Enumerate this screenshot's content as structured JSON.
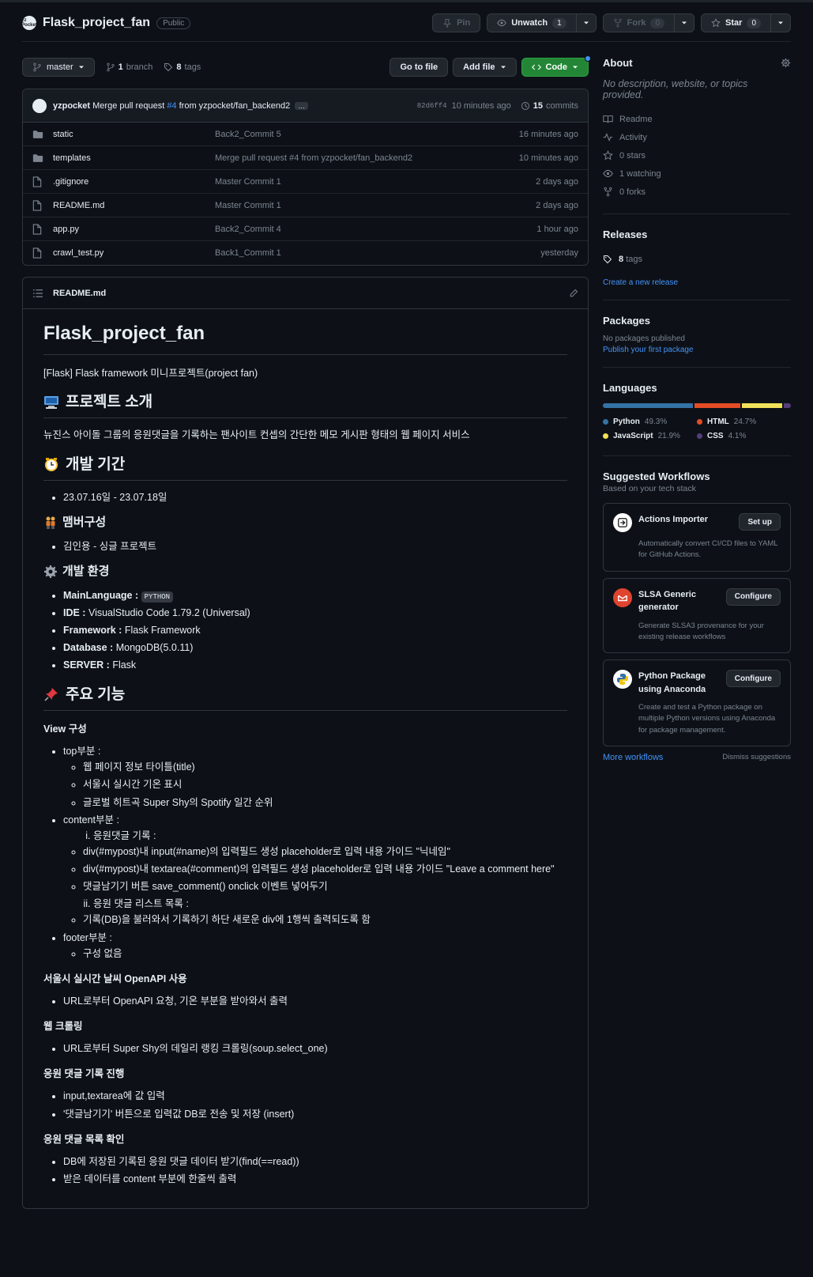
{
  "repo": {
    "name": "Flask_project_fan",
    "visibility": "Public",
    "avatar_text": "yz Pocket"
  },
  "header_actions": {
    "pin": "Pin",
    "unwatch": "Unwatch",
    "unwatch_count": "1",
    "fork": "Fork",
    "fork_count": "0",
    "star": "Star",
    "star_count": "0"
  },
  "branch_bar": {
    "branch": "master",
    "branch_count": "1",
    "branch_label": "branch",
    "tag_count": "8",
    "tag_label": "tags",
    "go_to_file": "Go to file",
    "add_file": "Add file",
    "code": "Code"
  },
  "latest_commit": {
    "author": "yzpocket",
    "message_prefix": "Merge pull request",
    "pr": "#4",
    "message_suffix": "from yzpocket/fan_backend2",
    "sha": "82d6ff4",
    "age": "10 minutes ago",
    "commit_count": "15",
    "commits_label": "commits"
  },
  "files": [
    {
      "type": "folder",
      "name": "static",
      "message": "Back2_Commit 5",
      "age": "16 minutes ago"
    },
    {
      "type": "folder",
      "name": "templates",
      "message": "Merge pull request #4 from yzpocket/fan_backend2",
      "age": "10 minutes ago"
    },
    {
      "type": "file",
      "name": ".gitignore",
      "message": "Master Commit 1",
      "age": "2 days ago"
    },
    {
      "type": "file",
      "name": "README.md",
      "message": "Master Commit 1",
      "age": "2 days ago"
    },
    {
      "type": "file",
      "name": "app.py",
      "message": "Back2_Commit 4",
      "age": "1 hour ago"
    },
    {
      "type": "file",
      "name": "crawl_test.py",
      "message": "Back1_Commit 1",
      "age": "yesterday"
    }
  ],
  "readme": {
    "filename": "README.md",
    "title": "Flask_project_fan",
    "subtitle": "[Flask] Flask framework 미니프로젝트(project fan)",
    "h_intro": "프로젝트 소개",
    "intro_text": "뉴진스 아이돌 그룹의 응원댓글을 기록하는 팬사이트 컨셉의 간단한 메모 게시판 형태의 웹 페이지 서비스",
    "h_period": "개발 기간",
    "period": "23.07.16일 - 23.07.18일",
    "h_members": "맴버구성",
    "members": "김인용 - 싱글 프로젝트",
    "h_env": "개발 환경",
    "env": [
      {
        "key": "MainLanguage :",
        "value": "PYTHON",
        "code": true
      },
      {
        "key": "IDE :",
        "value": "VisualStudio Code 1.79.2 (Universal)"
      },
      {
        "key": "Framework :",
        "value": "Flask Framework"
      },
      {
        "key": "Database :",
        "value": "MongoDB(5.0.11)"
      },
      {
        "key": "SERVER :",
        "value": "Flask"
      }
    ],
    "h_features": "주요 기능",
    "h_view": "View 구성",
    "top": "top부분 :",
    "top_items": [
      "웹 페이지 정보 타이틀(title)",
      "서울시 실시간 기온 표시",
      "글로벌 히트곡 Super Shy의 Spotify 일간 순위"
    ],
    "content": "content부분 :",
    "content_i": "응원댓글 기록 :",
    "content_i_items": [
      "div(#mypost)내 input(#name)의 입력필드 생성 placeholder로 입력 내용 가이드 \"닉네임\"",
      "div(#mypost)내 textarea(#comment)의 입력필드 생성 placeholder로 입력 내용 가이드 \"Leave a comment here\"",
      "댓글남기기 버튼 save_comment() onclick 이벤트 넣어두기"
    ],
    "content_ii": "응원 댓글 리스트 목록 :",
    "content_ii_items": [
      "기록(DB)을 불러와서 기록하기 하단 새로운 div에 1행씩 출력되도록 함"
    ],
    "footer": "footer부분 :",
    "footer_items": [
      "구성 없음"
    ],
    "h_weather": "서울시 실시간 날씨 OpenAPI 사용",
    "weather_items": [
      "URL로부터 OpenAPI 요청, 기온 부분을 받아와서 출력"
    ],
    "h_crawl": "웹 크롤링",
    "crawl_items": [
      "URL로부터 Super Shy의 데일리 랭킹 크롤링(soup.select_one)"
    ],
    "h_record": "응원 댓글 기록 진행",
    "record_items": [
      "input,textarea에 값 입력",
      "'댓글남기기' 버튼으로 입력값 DB로 전송 및 저장 (insert)"
    ],
    "h_list": "응원 댓글 목록 확인",
    "list_items": [
      "DB에 저장된 기록된 응원 댓글 데이터 받기(find(==read))",
      "받은 데이터를 content 부분에 한줄씩 출력"
    ]
  },
  "about": {
    "title": "About",
    "description": "No description, website, or topics provided.",
    "links": [
      {
        "icon": "book-icon",
        "label": "Readme"
      },
      {
        "icon": "pulse-icon",
        "label": "Activity"
      },
      {
        "icon": "star-icon",
        "label": "0 stars"
      },
      {
        "icon": "eye-icon",
        "label": "1 watching"
      },
      {
        "icon": "fork-icon",
        "label": "0 forks"
      }
    ]
  },
  "releases": {
    "title": "Releases",
    "tag_count": "8",
    "tag_label": "tags",
    "create_link": "Create a new release"
  },
  "packages": {
    "title": "Packages",
    "none": "No packages published",
    "publish_link": "Publish your first package"
  },
  "languages": {
    "title": "Languages",
    "items": [
      {
        "name": "Python",
        "percent": "49.3%",
        "value": 49.3,
        "color": "#3572A5"
      },
      {
        "name": "HTML",
        "percent": "24.7%",
        "value": 24.7,
        "color": "#e34c26"
      },
      {
        "name": "JavaScript",
        "percent": "21.9%",
        "value": 21.9,
        "color": "#f1e05a"
      },
      {
        "name": "CSS",
        "percent": "4.1%",
        "value": 4.1,
        "color": "#563d7c"
      }
    ]
  },
  "workflows": {
    "title": "Suggested Workflows",
    "subtitle": "Based on your tech stack",
    "cards": [
      {
        "title": "Actions Importer",
        "button": "Set up",
        "desc": "Automatically convert CI/CD files to YAML for GitHub Actions."
      },
      {
        "title": "SLSA Generic generator",
        "button": "Configure",
        "desc": "Generate SLSA3 provenance for your existing release workflows"
      },
      {
        "title": "Python Package using Anaconda",
        "button": "Configure",
        "desc": "Create and test a Python package on multiple Python versions using Anaconda for package management."
      }
    ],
    "more": "More workflows",
    "dismiss": "Dismiss suggestions"
  }
}
